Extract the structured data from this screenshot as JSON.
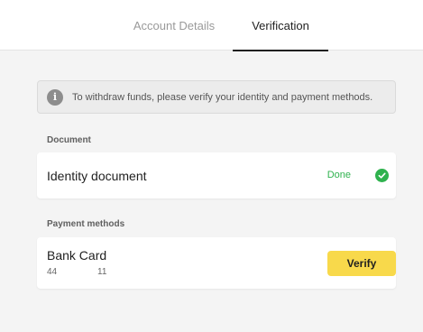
{
  "tabs": {
    "account_details": "Account Details",
    "verification": "Verification",
    "active": "verification"
  },
  "info_banner": {
    "icon": "info-icon",
    "text": "To withdraw funds, please verify your identity and payment methods."
  },
  "document_section": {
    "label": "Document",
    "items": [
      {
        "title": "Identity document",
        "status": "Done",
        "status_icon": "check-circle-icon",
        "status_color": "#2fb24e"
      }
    ]
  },
  "payment_section": {
    "label": "Payment methods",
    "items": [
      {
        "title": "Bank Card",
        "number_start": "44",
        "number_end": "11",
        "action_label": "Verify",
        "action_color": "#f8d94b"
      }
    ]
  }
}
